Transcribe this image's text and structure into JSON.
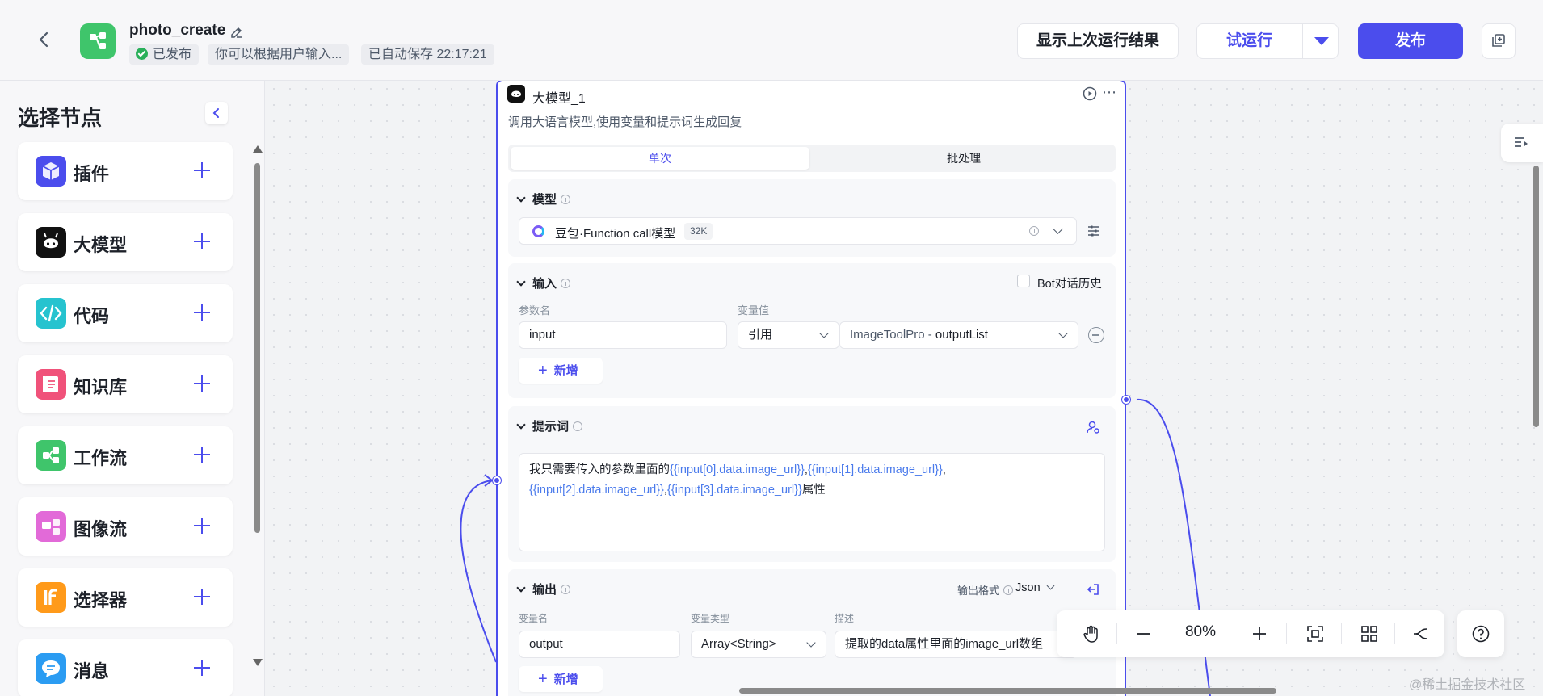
{
  "header": {
    "app_name": "photo_create",
    "status": "已发布",
    "description": "你可以根据用户输入...",
    "autosave": "已自动保存 22:17:21",
    "show_last_run_label": "显示上次运行结果",
    "trial_run_label": "试运行",
    "publish_label": "发布"
  },
  "sidebar": {
    "title": "选择节点",
    "items": [
      {
        "label": "插件",
        "icon": "plugin-icon",
        "color": "#4b4ded"
      },
      {
        "label": "大模型",
        "icon": "llm-icon",
        "color": "#111111"
      },
      {
        "label": "代码",
        "icon": "code-icon",
        "color": "#26c3cf"
      },
      {
        "label": "知识库",
        "icon": "knowledge-icon",
        "color": "#f0527a"
      },
      {
        "label": "工作流",
        "icon": "workflow-icon",
        "color": "#3fc56b"
      },
      {
        "label": "图像流",
        "icon": "imageflow-icon",
        "color": "#e26ad8"
      },
      {
        "label": "选择器",
        "icon": "if-icon",
        "color": "#ff9a1a"
      },
      {
        "label": "消息",
        "icon": "message-icon",
        "color": "#2b9cf2"
      }
    ]
  },
  "node": {
    "title": "大模型_1",
    "description": "调用大语言模型,使用变量和提示词生成回复",
    "tabs": {
      "single": "单次",
      "batch": "批处理"
    },
    "model_section": {
      "title": "模型",
      "model_name": "豆包·Function call模型",
      "context_badge": "32K"
    },
    "input_section": {
      "title": "输入",
      "bot_history_label": "Bot对话历史",
      "col_param": "参数名",
      "col_value": "变量值",
      "param_value": "input",
      "ref_type": "引用",
      "ref_source": "ImageToolPro",
      "ref_sep": " - ",
      "ref_field": "outputList",
      "add_label": "新增"
    },
    "prompt_section": {
      "title": "提示词",
      "text_prefix": "我只需要传入的参数里面的",
      "var1": "{{input[0].data.image_url}}",
      "comma1": ",",
      "var2": "{{input[1].data.image_url}}",
      "comma2": ",",
      "var3": "{{input[2].data.image_url}}",
      "comma3": ",",
      "var4": "{{input[3].data.image_url}}",
      "text_suffix": "属性"
    },
    "output_section": {
      "title": "输出",
      "format_label": "输出格式",
      "format_value": "Json",
      "col_name": "变量名",
      "col_type": "变量类型",
      "col_desc": "描述",
      "var_name": "output",
      "var_type": "Array<String>",
      "var_desc": "提取的data属性里面的image_url数组",
      "add_label": "新增"
    }
  },
  "zoom": {
    "value": "80%"
  },
  "watermark": "@稀土掘金技术社区",
  "colors": {
    "accent": "#4b4ded",
    "success": "#2ab05a"
  }
}
